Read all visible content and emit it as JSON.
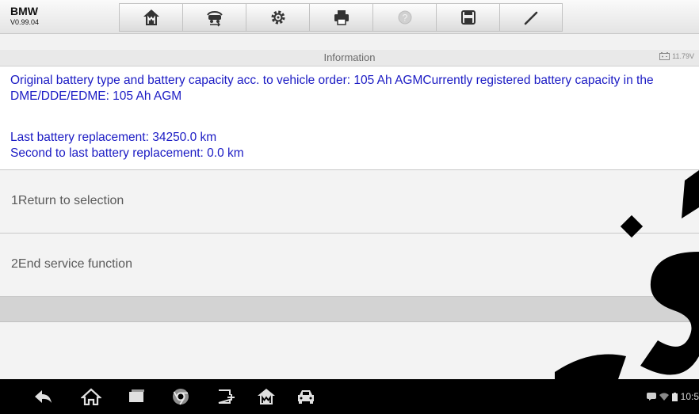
{
  "header": {
    "make": "BMW",
    "version": "V0.99.04",
    "toolbar": [
      {
        "name": "home-icon"
      },
      {
        "name": "vehicle-swap-icon"
      },
      {
        "name": "settings-icon"
      },
      {
        "name": "print-icon"
      },
      {
        "name": "help-icon"
      },
      {
        "name": "save-icon"
      },
      {
        "name": "edit-icon"
      }
    ]
  },
  "titlebar": {
    "title": "Information",
    "battery_voltage": "11.79V"
  },
  "info": {
    "line1": "Original battery type and battery capacity acc. to vehicle order: 105 Ah AGMCurrently registered battery capacity in the DME/DDE/EDME: 105 Ah AGM",
    "line2": "Last battery replacement: 34250.0 km",
    "line3": "Second to last battery replacement: 0.0 km"
  },
  "options": [
    {
      "label": "1Return to selection"
    },
    {
      "label": "2End service function"
    }
  ],
  "navbar": {
    "icons": [
      "back-icon",
      "home-icon",
      "recent-apps-icon",
      "chrome-icon",
      "vci-icon",
      "maxisys-icon",
      "car-icon"
    ],
    "clock": "10:5"
  },
  "colors": {
    "info_text": "#1b1bc4",
    "option_text": "#5a5a5a",
    "watermark": "#000000"
  }
}
